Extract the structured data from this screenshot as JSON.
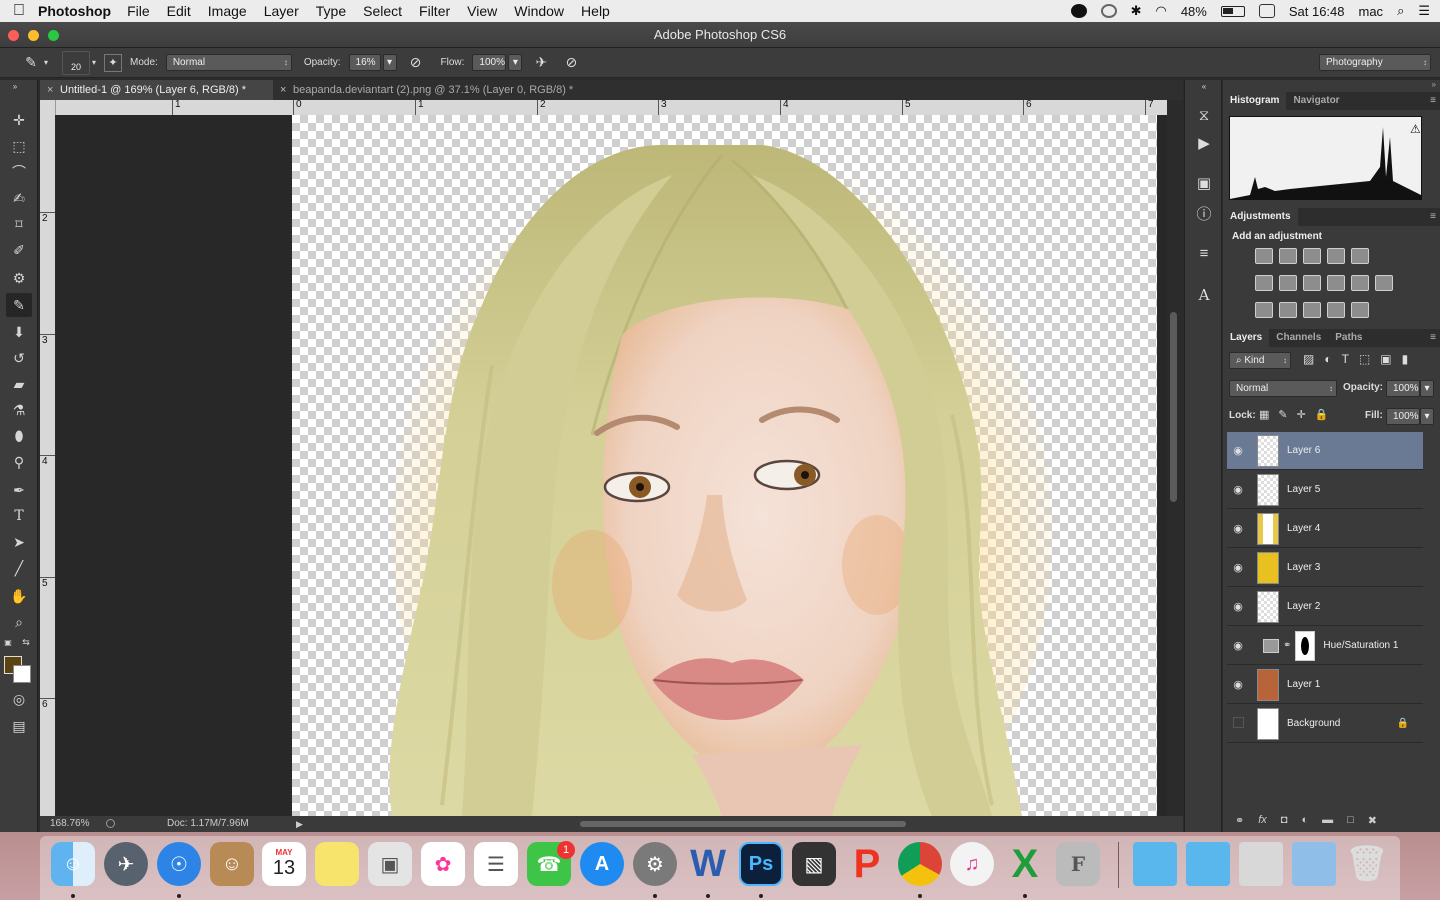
{
  "menubar": {
    "app_name": "Photoshop",
    "menus": [
      "File",
      "Edit",
      "Image",
      "Layer",
      "Type",
      "Select",
      "Filter",
      "View",
      "Window",
      "Help"
    ],
    "battery": "48%",
    "clock": "Sat 16:48",
    "user": "mac"
  },
  "window": {
    "title": "Adobe Photoshop CS6"
  },
  "options_bar": {
    "brush_size": "20",
    "mode_label": "Mode:",
    "mode_value": "Normal",
    "opacity_label": "Opacity:",
    "opacity_value": "16%",
    "flow_label": "Flow:",
    "flow_value": "100%",
    "workspace": "Photography"
  },
  "documents": {
    "tabs": [
      {
        "label": "Untitled-1 @ 169% (Layer 6, RGB/8) *",
        "active": true
      },
      {
        "label": "beapanda.deviantart (2).png @ 37.1% (Layer 0, RGB/8) *",
        "active": false
      }
    ]
  },
  "rulers": {
    "horizontal": [
      "1",
      "0",
      "1",
      "2",
      "3",
      "4",
      "5",
      "6",
      "7"
    ],
    "vertical": [
      "2",
      "3",
      "4",
      "5",
      "6"
    ]
  },
  "status_bar": {
    "zoom": "168.76%",
    "doc_info": "Doc: 1.17M/7.96M"
  },
  "panels": {
    "histogram_tabs": [
      "Histogram",
      "Navigator"
    ],
    "adjustments_tab": "Adjustments",
    "adjustments_heading": "Add an adjustment",
    "layers_tabs": [
      "Layers",
      "Channels",
      "Paths"
    ],
    "filter_kind": "Kind",
    "blend_mode": "Normal",
    "opacity_label": "Opacity:",
    "opacity_value": "100%",
    "lock_label": "Lock:",
    "fill_label": "Fill:",
    "fill_value": "100%",
    "layers": [
      {
        "name": "Layer 6",
        "visible": true,
        "selected": true
      },
      {
        "name": "Layer 5",
        "visible": true,
        "selected": false
      },
      {
        "name": "Layer 4",
        "visible": true,
        "selected": false
      },
      {
        "name": "Layer 3",
        "visible": true,
        "selected": false
      },
      {
        "name": "Layer 2",
        "visible": true,
        "selected": false
      },
      {
        "name": "Hue/Saturation 1",
        "visible": true,
        "selected": false
      },
      {
        "name": "Layer 1",
        "visible": true,
        "selected": false
      },
      {
        "name": "Background",
        "visible": false,
        "selected": false
      }
    ]
  },
  "colors": {
    "foreground": "#5b4410",
    "background": "#ffffff",
    "hair": "#d6d39a",
    "selected_layer": "#6a7a94"
  },
  "dock": {
    "calendar_month": "MAY",
    "calendar_day": "13",
    "facetime_badge": "1",
    "apps": [
      "Finder",
      "Launchpad",
      "Safari",
      "Contacts",
      "Calendar",
      "Notes",
      "Preview",
      "Photos",
      "Reminders",
      "FaceTime",
      "App Store",
      "System Preferences",
      "Word",
      "Photoshop",
      "Final Cut Pro",
      "Pages",
      "Chrome",
      "iTunes",
      "Excel",
      "Fontforge",
      "Folder",
      "Folder",
      "Network",
      "Utilities",
      "Trash"
    ]
  }
}
